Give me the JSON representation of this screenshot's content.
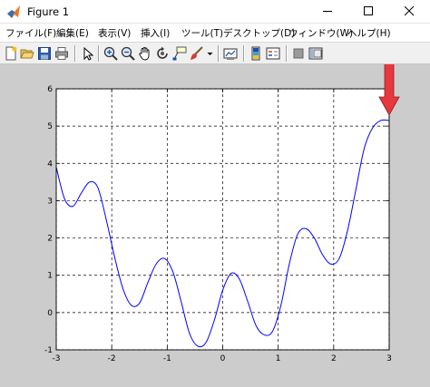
{
  "window": {
    "title": "Figure 1"
  },
  "menu": [
    {
      "label": "ファイル(F)"
    },
    {
      "label": "編集(E)"
    },
    {
      "label": "表示(V)"
    },
    {
      "label": "挿入(I)"
    },
    {
      "label": "ツール(T)"
    },
    {
      "label": "デスクトップ(D)"
    },
    {
      "label": "ウィンドウ(W)"
    },
    {
      "label": "ヘルプ(H)"
    }
  ],
  "toolbar": [
    "new-figure-icon",
    "open-file-icon",
    "save-icon",
    "print-icon",
    "edit-plot-arrow-icon",
    "zoom-in-icon",
    "zoom-out-icon",
    "pan-hand-icon",
    "rotate-3d-icon",
    "data-cursor-icon",
    "brush-icon",
    "brush-dropdown-icon",
    "link-plot-icon",
    "insert-colorbar-icon",
    "insert-legend-icon",
    "hide-plot-tools-icon",
    "show-plot-tools-icon"
  ],
  "colors": {
    "line": "#0000ff",
    "arrow": "#e8383d",
    "figure_bg": "#cccccc",
    "axes_bg": "#ffffff"
  },
  "chart_data": {
    "type": "line",
    "title": "",
    "xlabel": "",
    "ylabel": "",
    "xlim": [
      -3,
      3
    ],
    "ylim": [
      -1,
      6
    ],
    "xticks": [
      "-3",
      "-2",
      "-1",
      "0",
      "1",
      "2",
      "3"
    ],
    "yticks": [
      "-1",
      "0",
      "1",
      "2",
      "3",
      "4",
      "5",
      "6"
    ],
    "grid": true,
    "grid_style": "dashed",
    "annotation": {
      "type": "arrow",
      "color": "#e8383d",
      "target_x": 3.0,
      "target_y": 5.15
    },
    "series": [
      {
        "x": [
          -3.0,
          -2.85,
          -2.7,
          -2.55,
          -2.4,
          -2.25,
          -2.1,
          -1.95,
          -1.8,
          -1.65,
          -1.5,
          -1.35,
          -1.2,
          -1.05,
          -0.9,
          -0.75,
          -0.6,
          -0.45,
          -0.3,
          -0.15,
          0.0,
          0.15,
          0.3,
          0.45,
          0.6,
          0.75,
          0.9,
          1.05,
          1.2,
          1.35,
          1.5,
          1.65,
          1.8,
          1.95,
          2.1,
          2.25,
          2.4,
          2.55,
          2.7,
          2.85,
          3.0
        ],
        "y": [
          3.9,
          3.05,
          2.85,
          3.2,
          3.5,
          3.35,
          2.5,
          1.5,
          0.65,
          0.2,
          0.25,
          0.8,
          1.3,
          1.45,
          1.1,
          0.3,
          -0.55,
          -0.9,
          -0.8,
          -0.2,
          0.6,
          1.05,
          0.9,
          0.3,
          -0.35,
          -0.6,
          -0.5,
          0.2,
          1.3,
          2.1,
          2.25,
          2.0,
          1.55,
          1.3,
          1.45,
          2.2,
          3.3,
          4.4,
          4.95,
          5.15,
          5.15
        ]
      }
    ]
  }
}
